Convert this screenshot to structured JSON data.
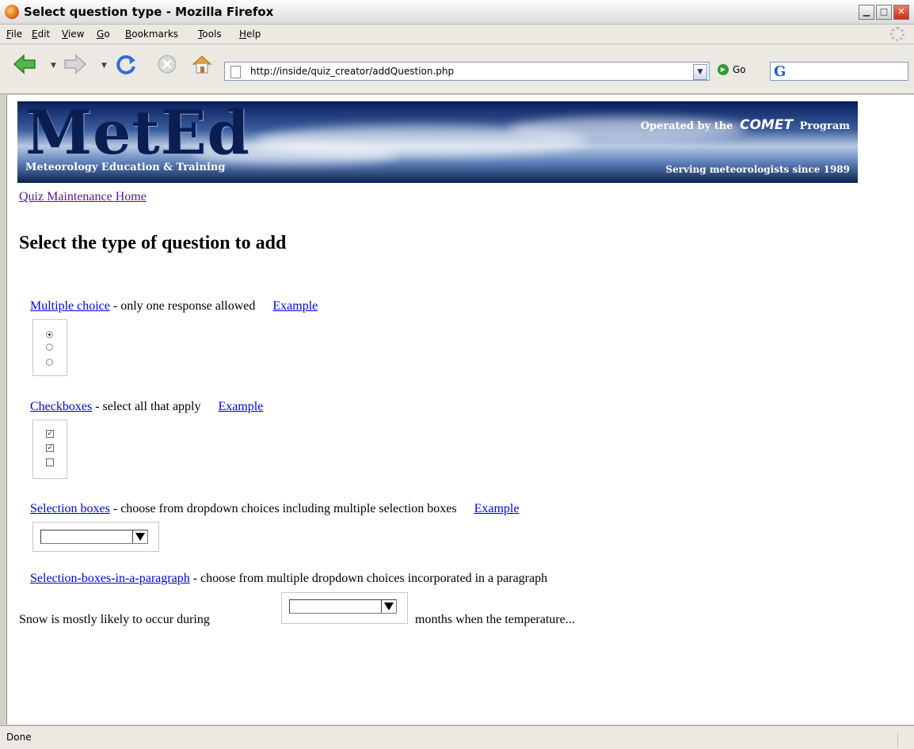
{
  "window": {
    "title": "Select question type - Mozilla Firefox",
    "buttons": [
      "minimize",
      "maximize",
      "close"
    ]
  },
  "menu": {
    "items": [
      {
        "label": "File",
        "accel": "F"
      },
      {
        "label": "Edit",
        "accel": "E"
      },
      {
        "label": "View",
        "accel": "V"
      },
      {
        "label": "Go",
        "accel": "G"
      },
      {
        "label": "Bookmarks",
        "accel": "B"
      },
      {
        "label": "Tools",
        "accel": "T"
      },
      {
        "label": "Help",
        "accel": "H"
      }
    ]
  },
  "toolbar": {
    "url": "http://inside/quiz_creator/addQuestion.php",
    "go_label": "Go",
    "search_engine": "G"
  },
  "banner": {
    "logo": "MetEd",
    "subtitle": "Meteorology Education & Training",
    "operated_prefix": "Operated by the",
    "operated_brand": "COMET",
    "operated_suffix": "Program",
    "serving": "Serving meteorologists since 1989"
  },
  "page": {
    "home_link": "Quiz Maintenance Home",
    "heading": "Select the type of question to add",
    "questions": [
      {
        "link": "Multiple choice",
        "desc": "- only one response allowed",
        "example": "Example"
      },
      {
        "link": "Checkboxes",
        "desc": "- select all that apply",
        "example": "Example"
      },
      {
        "link": "Selection boxes",
        "desc": "- choose from dropdown choices including multiple selection boxes",
        "example": "Example"
      },
      {
        "link": "Selection-boxes-in-a-paragraph",
        "desc": "- choose from multiple dropdown choices incorporated in a paragraph"
      }
    ],
    "paragraph_before": "Snow is mostly likely to occur during",
    "paragraph_after": "months when the temperature..."
  },
  "status": {
    "text": "Done"
  }
}
